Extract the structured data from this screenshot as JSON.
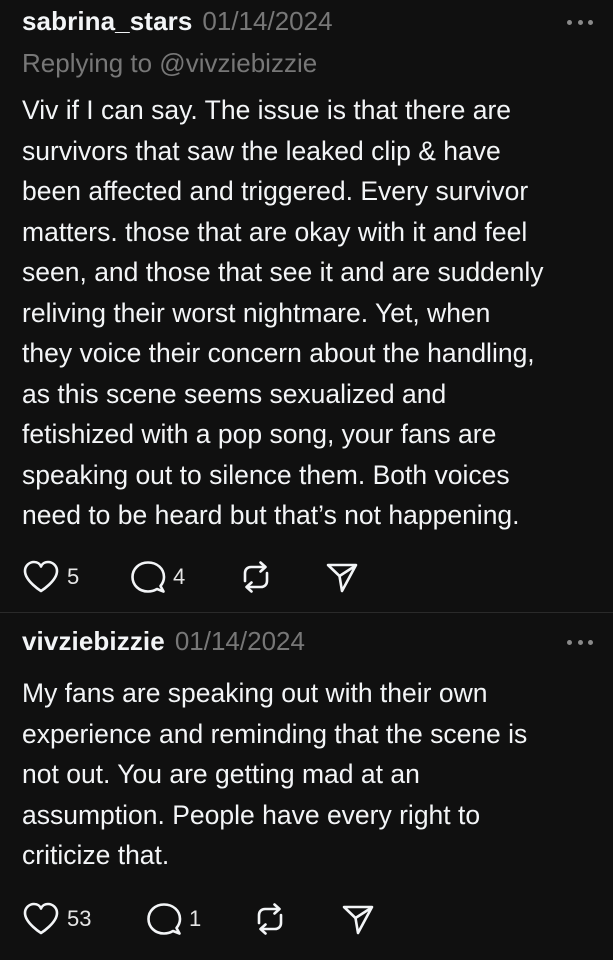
{
  "posts": [
    {
      "username": "sabrina_stars",
      "date": "01/14/2024",
      "reply_to": "Replying to @vivziebizzie",
      "text": "Viv if I can say. The issue is that there are\nsurvivors that saw the leaked clip & have\nbeen affected and triggered. Every survivor\nmatters. those that are okay with it and feel\nseen, and those that see it and are suddenly\nreliving their worst nightmare. Yet, when\nthey voice their concern about the handling,\nas this scene seems sexualized and\nfetishized with a pop song, your fans are\nspeaking out to silence them. Both voices\nneed to be heard but that’s not happening.",
      "likes": "5",
      "replies": "4",
      "icons": {
        "more": "more-icon",
        "like": "heart-icon",
        "reply": "comment-icon",
        "repost": "repost-icon",
        "share": "send-icon"
      }
    },
    {
      "username": "vivziebizzie",
      "date": "01/14/2024",
      "text": "My fans are speaking out with their own\nexperience and reminding that the scene is\nnot out. You are getting mad at an\nassumption. People have every right to\ncriticize that.",
      "likes": "53",
      "replies": "1",
      "icons": {
        "more": "more-icon",
        "like": "heart-icon",
        "reply": "comment-icon",
        "repost": "repost-icon",
        "share": "send-icon"
      }
    }
  ],
  "colors": {
    "background": "#101010",
    "primary_text": "#f3f5f7",
    "secondary_text": "#777777",
    "divider": "#2a2a2a"
  }
}
